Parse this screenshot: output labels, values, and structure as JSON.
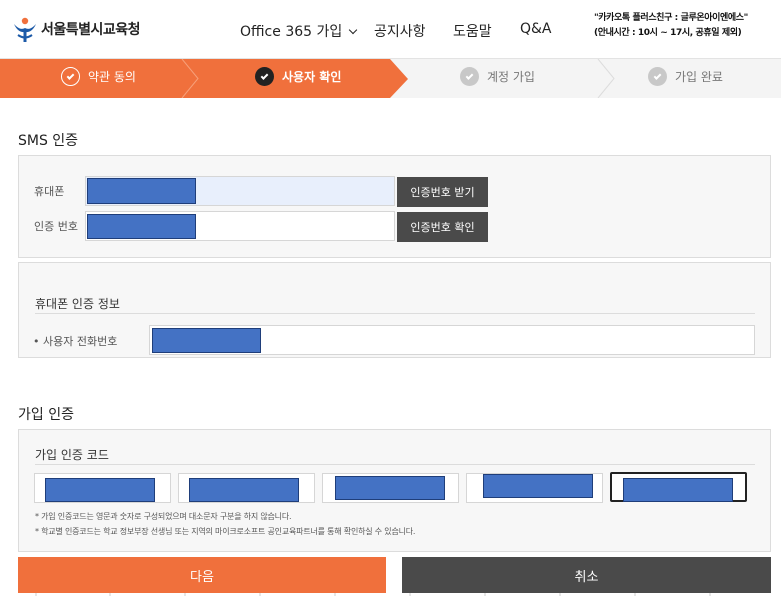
{
  "header": {
    "logo_text": "서울특별시교육청",
    "nav": [
      {
        "label": "Office 365 가입",
        "has_dropdown": true
      },
      {
        "label": "공지사항"
      },
      {
        "label": "도움말"
      },
      {
        "label": "Q&A"
      }
    ],
    "kakao_line1": "\"카카오톡 플러스친구 : 글루온아이엔에스\"",
    "kakao_line2": "(안내시간 : 10시 ~ 17시, 공휴일 제외)"
  },
  "steps": [
    {
      "label": "약관 동의",
      "state": "done"
    },
    {
      "label": "사용자 확인",
      "state": "current"
    },
    {
      "label": "계정 가입",
      "state": "todo"
    },
    {
      "label": "가입 완료",
      "state": "todo"
    }
  ],
  "sms": {
    "title": "SMS 인증",
    "phone_label": "휴대폰",
    "code_label": "인증 번호",
    "get_code_button": "인증번호 받기",
    "confirm_code_button": "인증번호 확인",
    "info_title": "휴대폰 인증 정보",
    "user_phone_label": "사용자 전화번호"
  },
  "join": {
    "title": "가입 인증",
    "code_title": "가입 인증 코드",
    "note1": "* 가입 인증코드는 영문과 숫자로 구성되었으며 대소문자 구분을 하지 않습니다.",
    "note2": "* 학교별 인증코드는 학교 정보부장 선생님 또는 지역의 마이크로소프트 공인교육파트너를 통해 확인하실 수 있습니다."
  },
  "actions": {
    "next": "다음",
    "cancel": "취소"
  },
  "colors": {
    "accent": "#f0703c",
    "dark_button": "#4a4a4a",
    "redacted": "#4472c4"
  }
}
